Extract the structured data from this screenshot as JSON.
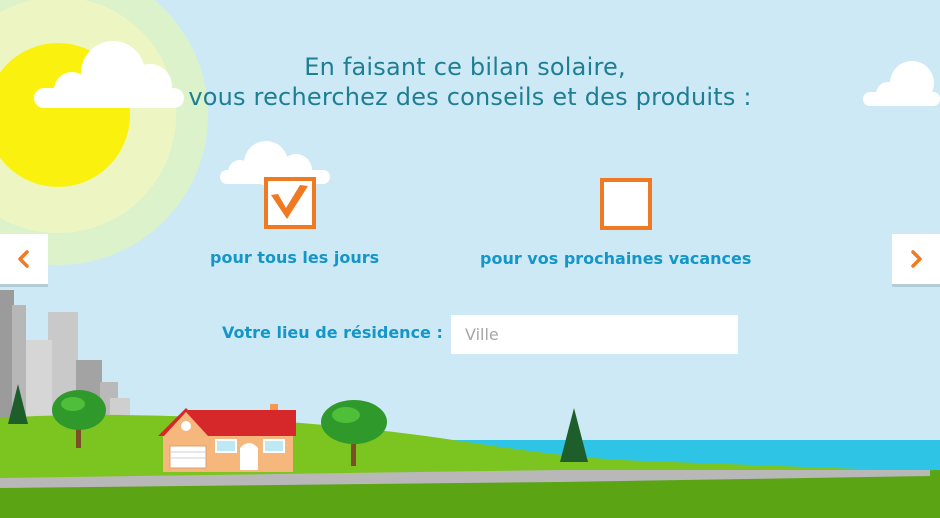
{
  "header": {
    "line1": "En faisant ce bilan solaire,",
    "line2": "vous recherchez des conseils et des produits :"
  },
  "options": [
    {
      "label": "pour tous les jours",
      "checked": true
    },
    {
      "label": "pour vos prochaines vacances",
      "checked": false
    }
  ],
  "residence": {
    "label": "Votre lieu de résidence :",
    "placeholder": "Ville",
    "value": ""
  },
  "nav": {
    "prev_icon": "chevron-left-icon",
    "next_icon": "chevron-right-icon"
  },
  "colors": {
    "sky": "#cde9f6",
    "accent": "#f07a22",
    "text_blue": "#1496c8",
    "title": "#1f7f92",
    "grass": "#7cc520",
    "sea": "#2ec4e6",
    "sun": "#fbf10f"
  }
}
